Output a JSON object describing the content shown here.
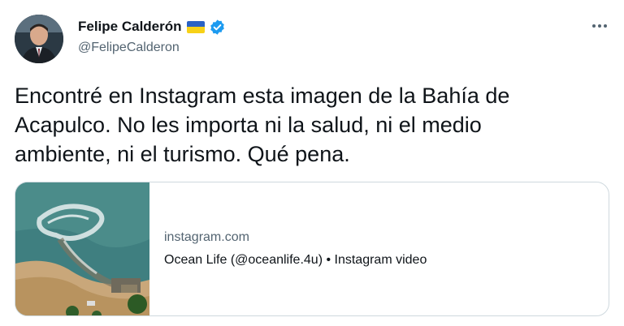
{
  "author": {
    "display_name": "Felipe Calderón",
    "handle": "@FelipeCalderon",
    "flag_colors": {
      "top": "#2a62c4",
      "bottom": "#f7d117"
    },
    "verified_color": "#1d9bf0",
    "avatar_icon": "profile-photo"
  },
  "menu": {
    "icon": "more-horizontal-icon"
  },
  "tweet": {
    "text": "Encontré en Instagram esta imagen de la Bahía de\nAcapulco. No les importa ni la salud, ni el medio\nambiente, ni el turismo. Qué pena."
  },
  "link_card": {
    "domain": "instagram.com",
    "title": "Ocean Life (@oceanlife.4u) • Instagram video",
    "thumbnail_icon": "aerial-bay-image"
  },
  "colors": {
    "text_primary": "#0f1419",
    "text_secondary": "#536471",
    "border": "#cfd9de",
    "background": "#ffffff"
  }
}
